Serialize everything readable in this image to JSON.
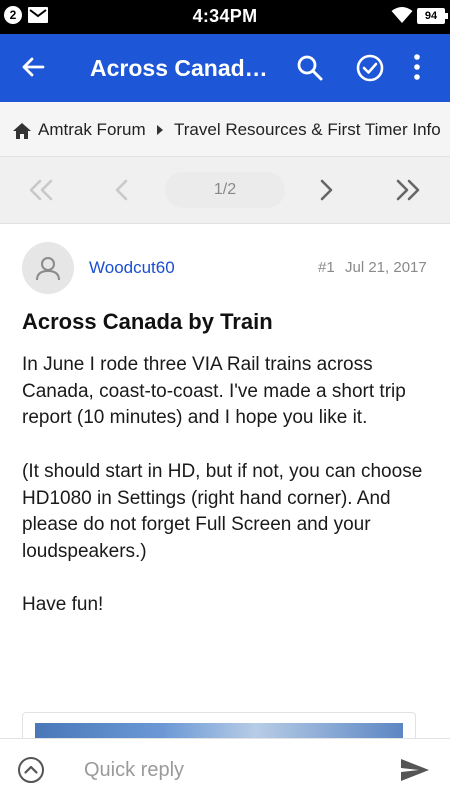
{
  "status_bar": {
    "notification_count": "2",
    "time": "4:34PM",
    "battery": "94"
  },
  "app_bar": {
    "title": "Across Canada by Train",
    "icons": [
      "back-arrow-icon",
      "search-icon",
      "check-circle-icon",
      "more-vert-icon"
    ],
    "color": "#1d56d6"
  },
  "breadcrumb": {
    "items": [
      "Amtrak Forum",
      "Travel Resources & First Timer Info"
    ]
  },
  "pager": {
    "page_label": "1/2"
  },
  "post": {
    "author": "Woodcut60",
    "number": "#1",
    "date": "Jul 21, 2017",
    "title": "Across Canada by Train",
    "paragraphs": [
      "In June I rode three VIA Rail trains across Canada, coast-to-coast. I've made a short trip report (10 minutes) and I hope you like it.",
      "(It should start in HD, but if not, you can choose HD1080 in Settings (right hand corner). And please do not forget Full Screen and your loudspeakers.)",
      "Have fun!"
    ]
  },
  "reply_bar": {
    "placeholder": "Quick reply"
  }
}
